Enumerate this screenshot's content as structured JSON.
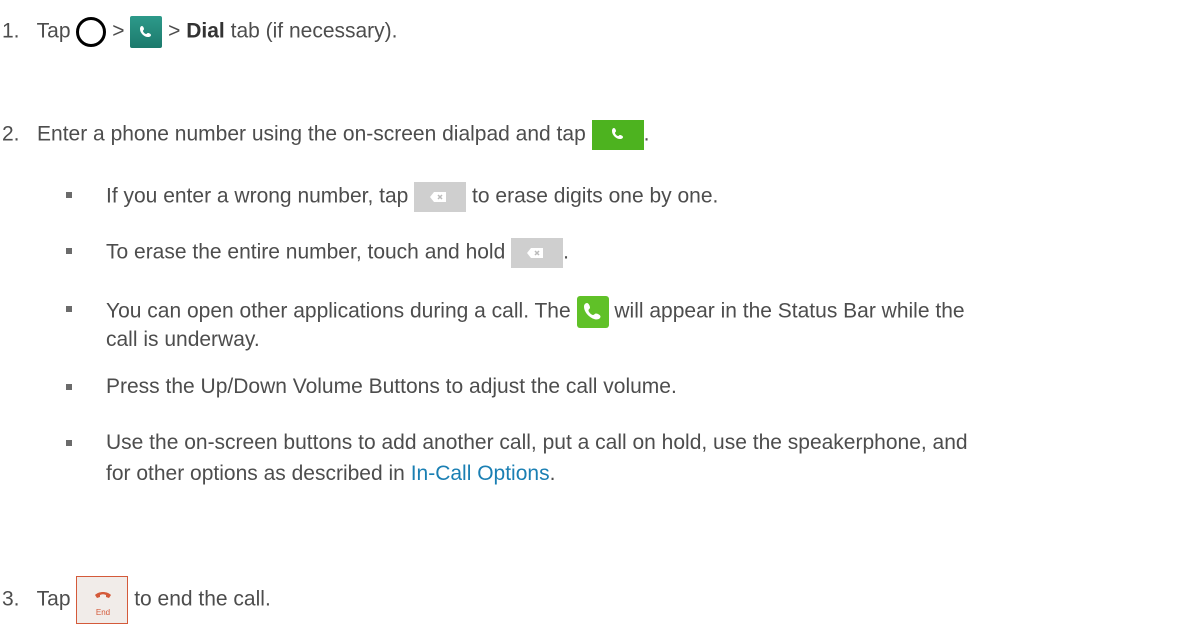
{
  "steps": [
    {
      "num": "1.",
      "t1": "Tap",
      "t2": ">",
      "t3": ">",
      "bold": "Dial",
      "t4": "tab (if necessary)."
    },
    {
      "num": "2.",
      "t1": "Enter a phone number using the on-screen dialpad and tap",
      "t2": "."
    },
    {
      "num": "3.",
      "t1": "Tap",
      "t2": "to end the call."
    }
  ],
  "bullets": [
    {
      "t1": "If you enter a wrong number, tap",
      "t2": "to erase digits one by one."
    },
    {
      "t1": "To erase the entire number, touch and hold",
      "t2": "."
    },
    {
      "l1a": "You can open other applications during a call. The",
      "l1b": "will appear in the Status Bar while the",
      "l2": "call is underway."
    },
    {
      "t1": "Press the Up/Down Volume Buttons to adjust the call volume."
    },
    {
      "l1": "Use the on-screen buttons to add another call, put a call on hold, use the speakerphone, and",
      "l2a": "for other options as described in",
      "link": "In-Call Options",
      "l2b": "."
    }
  ],
  "icons": {
    "end_label": "End",
    "green": "#4db31f",
    "teal": "#2d9a8a",
    "end_red": "#d45a3a",
    "link": "#1a7fb3"
  }
}
